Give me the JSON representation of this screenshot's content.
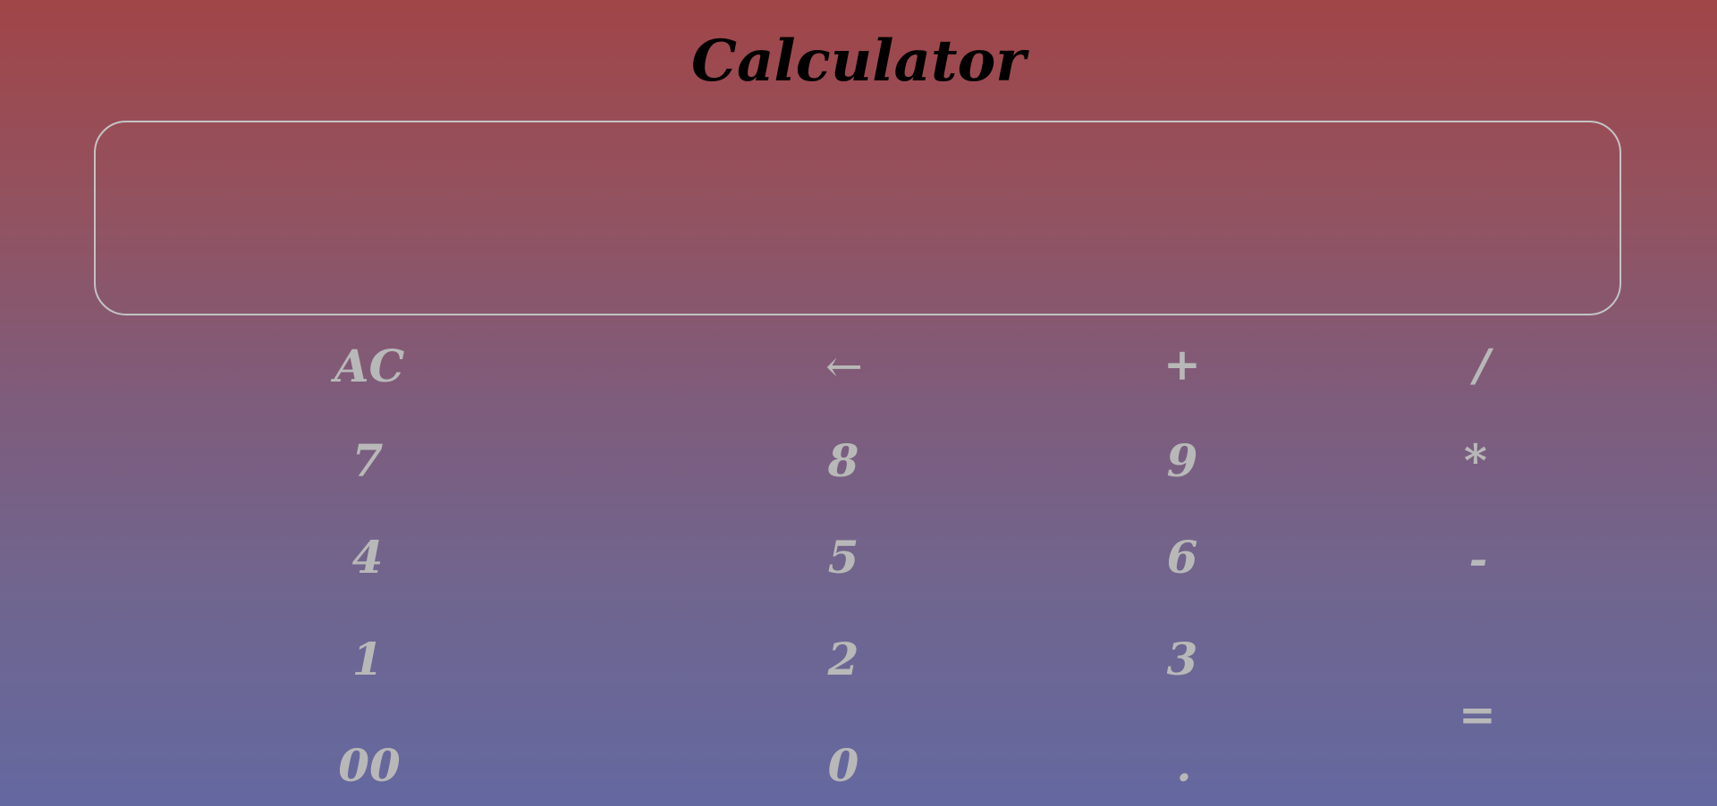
{
  "title": "Calculator",
  "display": {
    "value": "",
    "placeholder": ""
  },
  "keys": {
    "ac": "AC",
    "back": "←",
    "plus": "+",
    "divide": "/",
    "seven": "7",
    "eight": "8",
    "nine": "9",
    "multiply": "*",
    "four": "4",
    "five": "5",
    "six": "6",
    "minus": "-",
    "one": "1",
    "two": "2",
    "three": "3",
    "equals": "=",
    "double_zero": "00",
    "zero": "0",
    "dot": "."
  }
}
